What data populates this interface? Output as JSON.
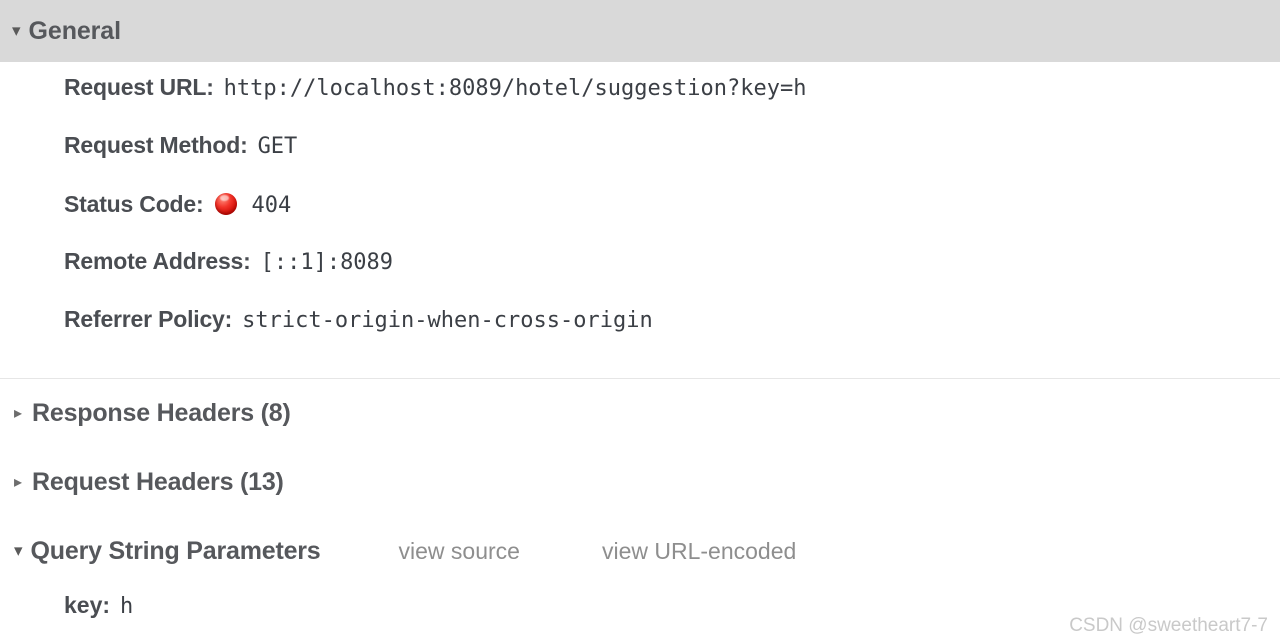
{
  "panel": {
    "watermark": "CSDN @sweetheart7-7"
  },
  "general": {
    "title": "General",
    "toggle_icon": "triangle-down-icon",
    "rows": [
      {
        "label": "Request URL:",
        "value": "http://localhost:8089/hotel/suggestion?key=h"
      },
      {
        "label": "Request Method:",
        "value": "GET"
      },
      {
        "label": "Status Code:",
        "value": "404",
        "status_icon": "red-circle-icon",
        "status_color": "#e01b0c"
      },
      {
        "label": "Remote Address:",
        "value": "[::1]:8089"
      },
      {
        "label": "Referrer Policy:",
        "value": "strict-origin-when-cross-origin"
      }
    ]
  },
  "response_headers": {
    "title": "Response Headers (8)",
    "toggle_icon": "triangle-right-icon"
  },
  "request_headers": {
    "title": "Request Headers (13)",
    "toggle_icon": "triangle-right-icon"
  },
  "query_string": {
    "title": "Query String Parameters",
    "toggle_icon": "triangle-down-icon",
    "view_source_label": "view source",
    "view_url_encoded_label": "view URL-encoded",
    "params": [
      {
        "key": "key:",
        "value": "h"
      }
    ]
  }
}
